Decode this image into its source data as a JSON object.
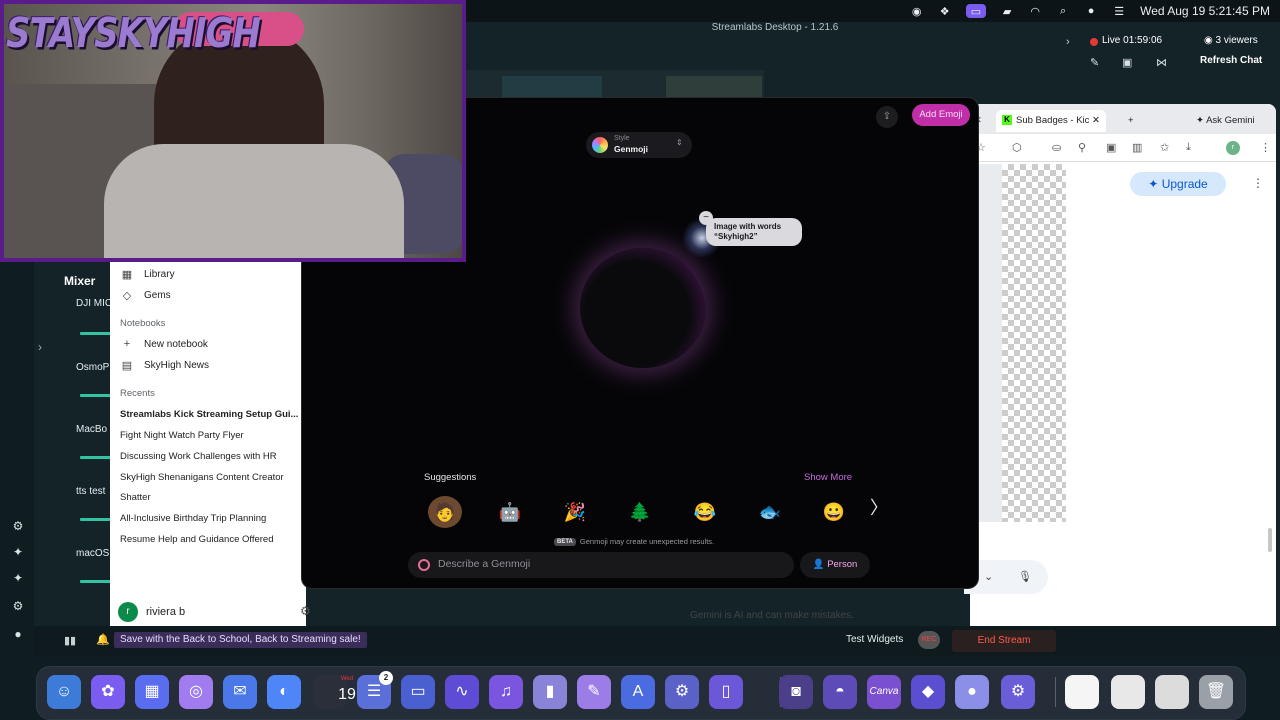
{
  "menubar": {
    "clock": "Wed Aug 19  5:21:45 PM",
    "icons": [
      "github-icon",
      "app-icon",
      "display-icon",
      "battery-icon",
      "wifi-icon",
      "search-icon",
      "user-icon",
      "control-center-icon"
    ]
  },
  "streamlabs": {
    "title": "Streamlabs Desktop - 1.21.6",
    "live_label": "Live",
    "live_time": "01:59:06",
    "viewers": "3 viewers",
    "refresh_chat": "Refresh Chat",
    "mixer_title": "Mixer",
    "mixer_items": [
      "DJI MIC",
      "OsmoP",
      "MacBo",
      "tts test",
      "macOS"
    ],
    "promo": "Save with the Back to School, Back to Streaming sale!",
    "test_widgets": "Test Widgets",
    "rec_label": "REC",
    "end_stream": "End Stream"
  },
  "webcam": {
    "logo_text": "STAYSKYHIGH"
  },
  "gemini_sidebar": {
    "items": [
      {
        "icon": "library-icon",
        "label": "Library"
      },
      {
        "icon": "gem-icon",
        "label": "Gems"
      }
    ],
    "notebooks_heading": "Notebooks",
    "notebooks": [
      {
        "icon": "plus-icon",
        "label": "New notebook"
      },
      {
        "icon": "notebook-icon",
        "label": "SkyHigh News"
      }
    ],
    "recents_heading": "Recents",
    "recents": [
      "Streamlabs Kick Streaming Setup Gui...",
      "Fight Night Watch Party Flyer",
      "Discussing Work Challenges with HR",
      "SkyHigh Shenanigans Content Creator",
      "Shatter",
      "All-Inclusive Birthday Trip Planning",
      "Resume Help and Guidance Offered"
    ],
    "user_initial": "r",
    "user_name": "riviera b"
  },
  "browser": {
    "tabs": [
      {
        "label": "Sub Badges - Kic",
        "active": true
      },
      {
        "label": "+",
        "active": false
      }
    ],
    "ask_gemini": "Ask Gemini",
    "upgrade": "Upgrade",
    "disclaimer": "Gemini is AI and can make mistakes."
  },
  "genmoji": {
    "add_emoji": "Add Emoji",
    "style_label": "Style",
    "style_value": "Genmoji",
    "tag_line1": "Image with words",
    "tag_line2": "“Skyhigh2”",
    "suggestions_title": "Suggestions",
    "show_more": "Show More",
    "suggestions": [
      "🧑",
      "🤖",
      "🎉",
      "🌲",
      "😂",
      "🐟",
      "😀"
    ],
    "beta_badge": "BETA",
    "beta_text": "Genmoji may create unexpected results.",
    "input_placeholder": "Describe a Genmoji",
    "person_button": "Person"
  },
  "dock": {
    "calendar_day": "Wed",
    "calendar_date": "19",
    "reminders_badge": "2",
    "canva_label": "Canva"
  },
  "colors": {
    "accent_purple": "#5a1c8a",
    "genmoji_accent": "#c12fa8",
    "end_stream": "#ff5a4e",
    "live_dot": "#e53935"
  }
}
